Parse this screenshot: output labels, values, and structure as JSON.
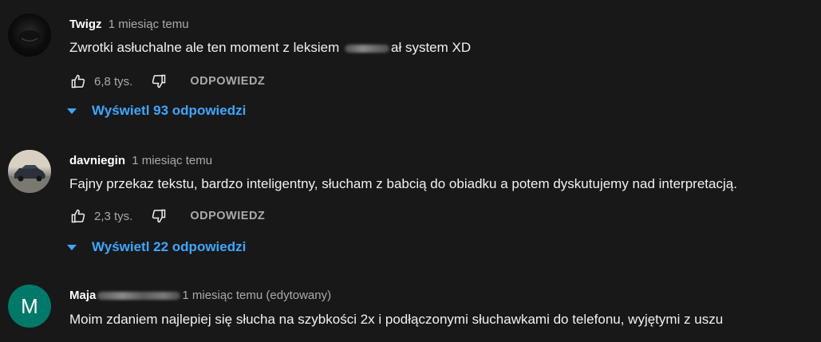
{
  "comments": [
    {
      "author": "Twigz",
      "timestamp": "1 miesiąc temu",
      "text_before": "Zwrotki asłuchalne ale ten moment z leksiem ",
      "text_after": "ał system XD",
      "likes": "6,8 tys.",
      "reply_label": "ODPOWIEDZ",
      "replies_label": "Wyświetl 93 odpowiedzi",
      "avatar_icon": "dark-avatar"
    },
    {
      "author": "davniegin",
      "timestamp": "1 miesiąc temu",
      "text": "Fajny przekaz tekstu, bardzo inteligentny, słucham z babcią do obiadku a potem dyskutujemy nad interpretacją.",
      "likes": "2,3 tys.",
      "reply_label": "ODPOWIEDZ",
      "replies_label": "Wyświetl 22 odpowiedzi",
      "avatar_icon": "car-photo-avatar"
    },
    {
      "author": "Maja",
      "timestamp": "1 miesiąc temu (edytowany)",
      "text": "Moim zdaniem najlepiej się słucha na szybkości 2x i podłączonymi słuchawkami do telefonu, wyjętymi z uszu",
      "avatar_letter": "M",
      "avatar_color": "#00796b"
    }
  ],
  "colors": {
    "background": "#181818",
    "link": "#3ea6ff",
    "secondary_text": "#aaaaaa"
  }
}
